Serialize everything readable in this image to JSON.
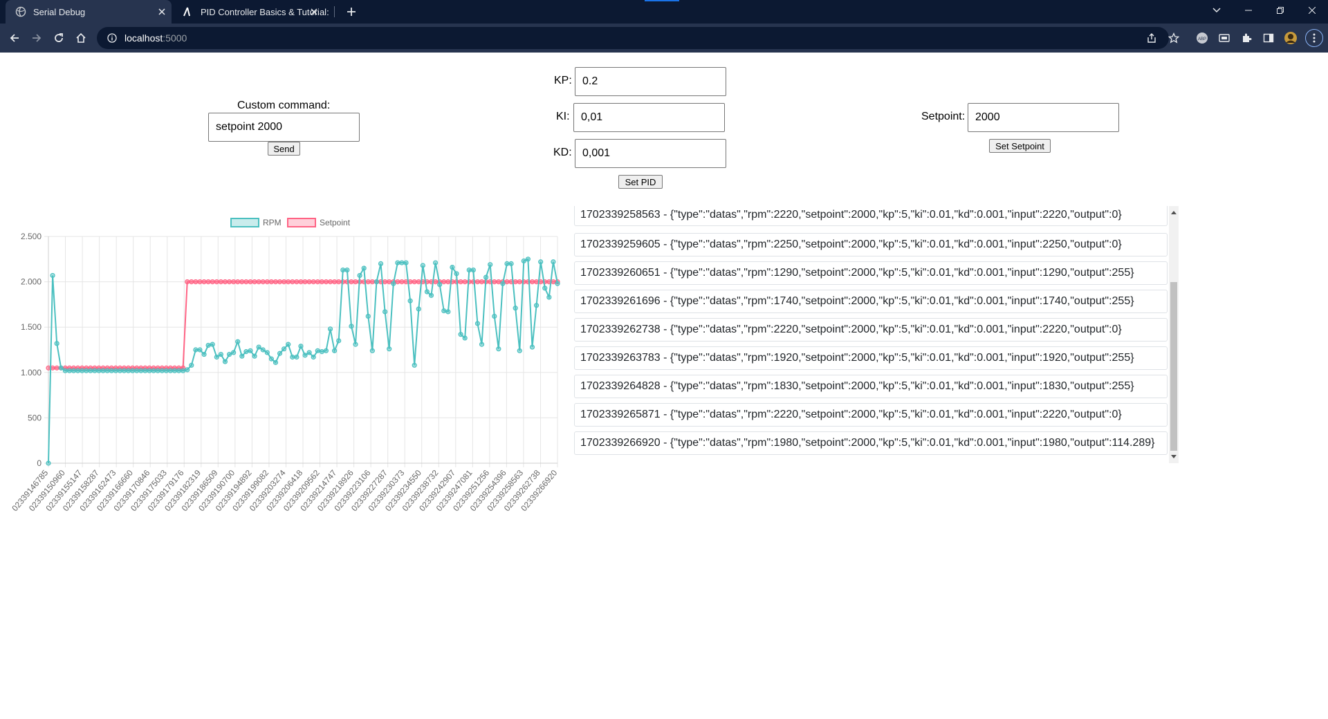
{
  "browser": {
    "tabs": [
      {
        "title": "Serial Debug",
        "active": true,
        "icon": "globe-icon"
      },
      {
        "title": "PID Controller Basics & Tutorial:",
        "active": false,
        "icon": "pid-icon"
      }
    ],
    "url_host": "localhost",
    "url_port": ":5000"
  },
  "custom_command": {
    "label": "Custom command:",
    "value": "setpoint 2000",
    "send_label": "Send"
  },
  "pid": {
    "kp_label": "KP:",
    "kp_value": "0.2",
    "ki_label": "KI:",
    "ki_value": "0,01",
    "kd_label": "KD:",
    "kd_value": "0,001",
    "set_label": "Set PID"
  },
  "setpoint": {
    "label": "Setpoint:",
    "value": "2000",
    "set_label": "Set Setpoint"
  },
  "chart_data": {
    "type": "line",
    "legend_position": "top",
    "grid": true,
    "ylim": [
      0,
      2500
    ],
    "y_ticks": [
      "0",
      "500",
      "1.000",
      "1.500",
      "2.000",
      "2.500"
    ],
    "x_tick_labels": [
      "02339146785",
      "02339150960",
      "02339155147",
      "02339158287",
      "02339162473",
      "02339166660",
      "02339170846",
      "02339175033",
      "02339179176",
      "02339182319",
      "02339186509",
      "02339190700",
      "02339194892",
      "02339199082",
      "02339203274",
      "02339206418",
      "02339209562",
      "02339214747",
      "02339218926",
      "02339223106",
      "02339227287",
      "02339230373",
      "02339234550",
      "02339238732",
      "02339242907",
      "02339247081",
      "02339251256",
      "02339254396",
      "02339258563",
      "02339262738",
      "02339266920"
    ],
    "series": [
      {
        "name": "RPM",
        "color": "#4bc0c0",
        "values": [
          0,
          2070,
          1320,
          1050,
          1020,
          1020,
          1020,
          1020,
          1020,
          1020,
          1020,
          1020,
          1020,
          1020,
          1020,
          1020,
          1020,
          1020,
          1020,
          1020,
          1020,
          1020,
          1020,
          1020,
          1020,
          1020,
          1020,
          1020,
          1020,
          1020,
          1020,
          1020,
          1020,
          1030,
          1080,
          1250,
          1250,
          1200,
          1300,
          1310,
          1170,
          1200,
          1120,
          1200,
          1220,
          1340,
          1180,
          1230,
          1240,
          1180,
          1280,
          1250,
          1220,
          1150,
          1110,
          1210,
          1260,
          1310,
          1170,
          1170,
          1290,
          1190,
          1220,
          1170,
          1240,
          1230,
          1240,
          1480,
          1240,
          1350,
          2130,
          2130,
          1510,
          1310,
          2070,
          2150,
          1620,
          1240,
          2000,
          2200,
          1670,
          1260,
          1980,
          2210,
          2210,
          2210,
          1790,
          1080,
          1700,
          2180,
          1890,
          1850,
          2210,
          1970,
          1680,
          1670,
          2160,
          2090,
          1420,
          1380,
          2130,
          2130,
          1540,
          1310,
          2050,
          2190,
          1620,
          1260,
          1980,
          2200,
          2200,
          1710,
          1240,
          2230,
          2250,
          1280,
          1740,
          2220,
          1930,
          1830,
          2220,
          1980
        ]
      },
      {
        "name": "Setpoint",
        "color": "#ff6384",
        "values": [
          1050,
          1050,
          1050,
          1050,
          1050,
          1050,
          1050,
          1050,
          1050,
          1050,
          1050,
          1050,
          1050,
          1050,
          1050,
          1050,
          1050,
          1050,
          1050,
          1050,
          1050,
          1050,
          1050,
          1050,
          1050,
          1050,
          1050,
          1050,
          1050,
          1050,
          1050,
          1050,
          1050,
          2000,
          2000,
          2000,
          2000,
          2000,
          2000,
          2000,
          2000,
          2000,
          2000,
          2000,
          2000,
          2000,
          2000,
          2000,
          2000,
          2000,
          2000,
          2000,
          2000,
          2000,
          2000,
          2000,
          2000,
          2000,
          2000,
          2000,
          2000,
          2000,
          2000,
          2000,
          2000,
          2000,
          2000,
          2000,
          2000,
          2000,
          2000,
          2000,
          2000,
          2000,
          2000,
          2000,
          2000,
          2000,
          2000,
          2000,
          2000,
          2000,
          2000,
          2000,
          2000,
          2000,
          2000,
          2000,
          2000,
          2000,
          2000,
          2000,
          2000,
          2000,
          2000,
          2000,
          2000,
          2000,
          2000,
          2000,
          2000,
          2000,
          2000,
          2000,
          2000,
          2000,
          2000,
          2000,
          2000,
          2000,
          2000,
          2000,
          2000,
          2000,
          2000,
          2000,
          2000,
          2000,
          2000,
          2000,
          2000,
          2000
        ]
      }
    ]
  },
  "log": [
    "1702339258563 - {\"type\":\"datas\",\"rpm\":2220,\"setpoint\":2000,\"kp\":5,\"ki\":0.01,\"kd\":0.001,\"input\":2220,\"output\":0}",
    "1702339259605 - {\"type\":\"datas\",\"rpm\":2250,\"setpoint\":2000,\"kp\":5,\"ki\":0.01,\"kd\":0.001,\"input\":2250,\"output\":0}",
    "1702339260651 - {\"type\":\"datas\",\"rpm\":1290,\"setpoint\":2000,\"kp\":5,\"ki\":0.01,\"kd\":0.001,\"input\":1290,\"output\":255}",
    "1702339261696 - {\"type\":\"datas\",\"rpm\":1740,\"setpoint\":2000,\"kp\":5,\"ki\":0.01,\"kd\":0.001,\"input\":1740,\"output\":255}",
    "1702339262738 - {\"type\":\"datas\",\"rpm\":2220,\"setpoint\":2000,\"kp\":5,\"ki\":0.01,\"kd\":0.001,\"input\":2220,\"output\":0}",
    "1702339263783 - {\"type\":\"datas\",\"rpm\":1920,\"setpoint\":2000,\"kp\":5,\"ki\":0.01,\"kd\":0.001,\"input\":1920,\"output\":255}",
    "1702339264828 - {\"type\":\"datas\",\"rpm\":1830,\"setpoint\":2000,\"kp\":5,\"ki\":0.01,\"kd\":0.001,\"input\":1830,\"output\":255}",
    "1702339265871 - {\"type\":\"datas\",\"rpm\":2220,\"setpoint\":2000,\"kp\":5,\"ki\":0.01,\"kd\":0.001,\"input\":2220,\"output\":0}",
    "1702339266920 - {\"type\":\"datas\",\"rpm\":1980,\"setpoint\":2000,\"kp\":5,\"ki\":0.01,\"kd\":0.001,\"input\":1980,\"output\":114.289}"
  ]
}
